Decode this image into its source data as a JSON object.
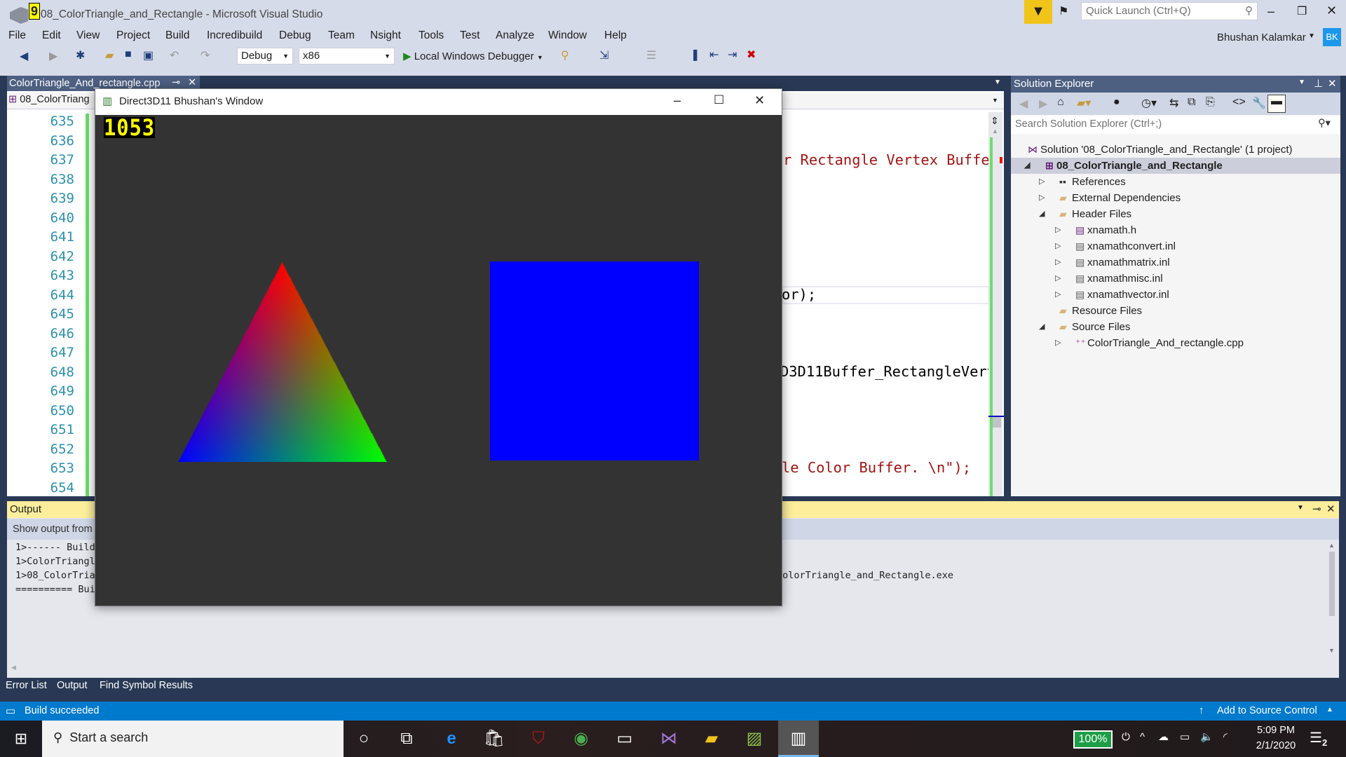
{
  "title": "08_ColorTriangle_and_Rectangle - Microsoft Visual Studio",
  "badge_number": "9",
  "quick_launch_placeholder": "Quick Launch (Ctrl+Q)",
  "user": {
    "name": "Bhushan Kalamkar",
    "initials": "BK"
  },
  "menu": [
    "File",
    "Edit",
    "View",
    "Project",
    "Build",
    "Incredibuild",
    "Debug",
    "Team",
    "Nsight",
    "Tools",
    "Test",
    "Analyze",
    "Window",
    "Help"
  ],
  "toolbar": {
    "config": "Debug",
    "platform": "x86",
    "debugger": "Local Windows Debugger"
  },
  "doc_tab": "ColorTriangle_And_rectangle.cpp",
  "nav_project": "08_ColorTriang",
  "editor": {
    "line_numbers": [
      "635",
      "636",
      "637",
      "638",
      "639",
      "640",
      "641",
      "642",
      "643",
      "644",
      "645",
      "646",
      "647",
      "648",
      "649",
      "650",
      "651",
      "652",
      "653",
      "654"
    ],
    "code": {
      "l637": "r Rectangle Vertex Buffer",
      "l644": "or);",
      "l648": "D3D11Buffer_RectangleVert",
      "l653": "le Color Buffer. \\n\");"
    }
  },
  "d3d_window": {
    "title": "Direct3D11 Bhushan's Window",
    "fps": "1053",
    "triangle_colors": {
      "top": "#ff0000",
      "left": "#0000ff",
      "right": "#00ff00"
    },
    "rectangle_color": "#0000ff",
    "background": "#333333"
  },
  "solution_explorer": {
    "title": "Solution Explorer",
    "search_placeholder": "Search Solution Explorer (Ctrl+;)",
    "items": [
      {
        "label": "Solution '08_ColorTriangle_and_Rectangle' (1 project)"
      },
      {
        "label": "08_ColorTriangle_and_Rectangle"
      },
      {
        "label": "References"
      },
      {
        "label": "External Dependencies"
      },
      {
        "label": "Header Files"
      },
      {
        "label": "xnamath.h"
      },
      {
        "label": "xnamathconvert.inl"
      },
      {
        "label": "xnamathmatrix.inl"
      },
      {
        "label": "xnamathmisc.inl"
      },
      {
        "label": "xnamathvector.inl"
      },
      {
        "label": "Resource Files"
      },
      {
        "label": "Source Files"
      },
      {
        "label": "ColorTriangle_And_rectangle.cpp"
      }
    ]
  },
  "output": {
    "title": "Output",
    "show_from": "Show output from",
    "lines": [
      "1>------ Build",
      "1>ColorTriangl",
      "1>08_ColorTria",
      "========== Bui"
    ],
    "line3_right": "ColorTriangle_and_Rectangle.exe"
  },
  "bottom_tabs": [
    "Error List",
    "Output",
    "Find Symbol Results"
  ],
  "status": {
    "text": "Build succeeded",
    "source_control": "Add to Source Control"
  },
  "taskbar": {
    "search": "Start a search",
    "battery": "100%",
    "time": "5:09 PM",
    "date": "2/1/2020",
    "notifications": "2"
  }
}
